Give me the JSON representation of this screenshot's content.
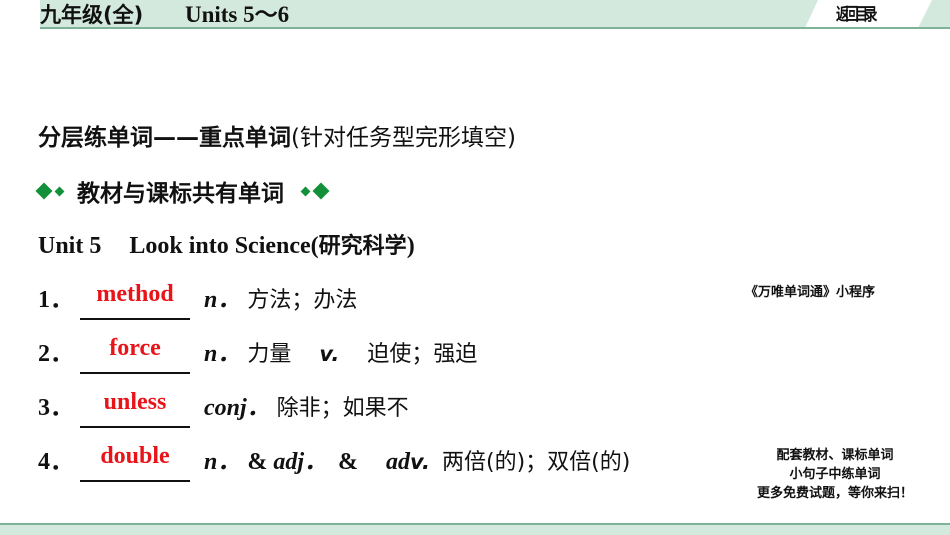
{
  "header": {
    "grade": "九年级(全)",
    "units": "Units 5～6",
    "return_label": "返回目录",
    "band_color": "#d3e9de",
    "line_color": "#7db396"
  },
  "section": {
    "title_bold": "分层练单词——重点单词",
    "title_light": "(针对任务型完形填空)",
    "subtitle": "教材与课标共有单词",
    "diamond_color": "#13913a"
  },
  "unit": {
    "label": "Unit 5",
    "title": "Look into Science(",
    "title_cn": "研究科学",
    "title_close": ")"
  },
  "vocab": [
    {
      "num": "1．",
      "answer": "method",
      "pos": "n．",
      "definition": "方法；办法"
    },
    {
      "num": "2．",
      "answer": "force",
      "pos": "n．",
      "definition": "力量",
      "pos2": "v.",
      "definition2": "迫使；强迫"
    },
    {
      "num": "3．",
      "answer": "unless",
      "pos": "conj．",
      "definition": "除非；如果不"
    },
    {
      "num": "4．",
      "answer": "double",
      "pos": "n．",
      "amp1": "&",
      "pos_b": "adj．",
      "amp2": "&",
      "pos_c": "ad",
      "pos_c2": "v.",
      "definition": "两倍(的)；双倍(的)"
    }
  ],
  "side": {
    "mini_program": "《万唯单词通》小程序",
    "promo_lines": [
      "配套教材、课标单词",
      "小句子中练单词",
      "更多免费试题，等你来扫！"
    ]
  },
  "colors": {
    "answer": "#e8141a"
  }
}
